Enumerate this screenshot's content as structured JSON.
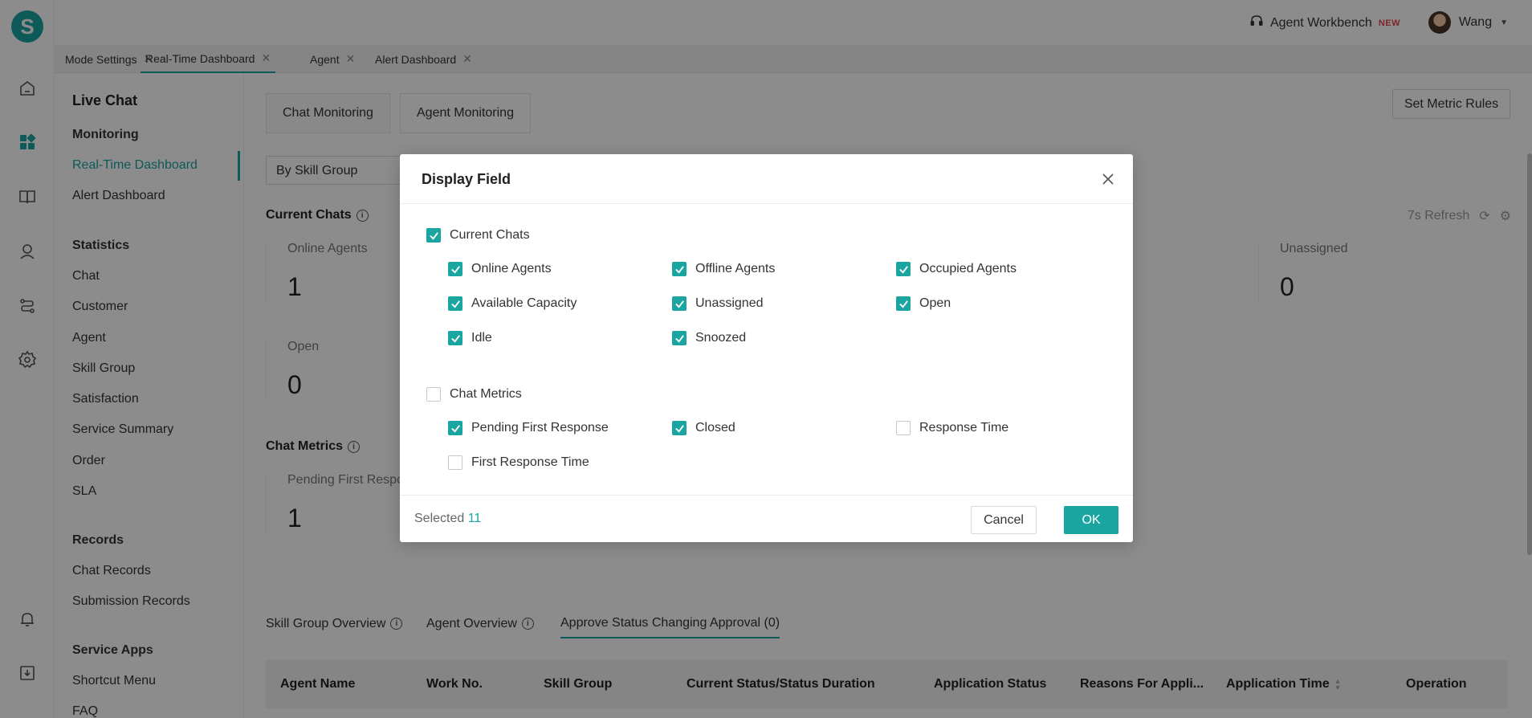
{
  "brand": {
    "logo_letter": "S",
    "accent": "#1aa5a0"
  },
  "topbar": {
    "workbench_label": "Agent Workbench",
    "new_badge": "NEW",
    "user_name": "Wang"
  },
  "page_tabs": [
    {
      "label": "Mode Settings",
      "active": false
    },
    {
      "label": "Real-Time Dashboard",
      "active": true
    },
    {
      "label": "Agent",
      "active": false
    },
    {
      "label": "Alert Dashboard",
      "active": false
    }
  ],
  "sidebar": {
    "title": "Live Chat",
    "groups": {
      "monitoring": "Monitoring",
      "statistics": "Statistics",
      "records": "Records",
      "service_apps": "Service Apps"
    },
    "items": {
      "realtime": "Real-Time Dashboard",
      "alert": "Alert Dashboard",
      "chat": "Chat",
      "customer": "Customer",
      "agent": "Agent",
      "skill_group": "Skill Group",
      "satisfaction": "Satisfaction",
      "service_summary": "Service Summary",
      "order": "Order",
      "sla": "SLA",
      "chat_records": "Chat Records",
      "submission_records": "Submission Records",
      "shortcut_menu": "Shortcut Menu",
      "faq": "FAQ"
    }
  },
  "main": {
    "tabs": {
      "chat_monitoring": "Chat Monitoring",
      "agent_monitoring": "Agent Monitoring"
    },
    "set_metric_rules": "Set Metric Rules",
    "group_select": "By Skill Group",
    "current_chats_title": "Current Chats",
    "refresh_label": "7s Refresh",
    "cards": {
      "online_agents": {
        "label": "Online Agents",
        "value": "1"
      },
      "unassigned": {
        "label": "Unassigned",
        "value": "0"
      },
      "open": {
        "label": "Open",
        "value": "0"
      },
      "pending_first": {
        "label": "Pending First Respon",
        "value": "1"
      }
    },
    "chat_metrics_title": "Chat Metrics",
    "bottom_tabs": {
      "skill_group_overview": "Skill Group Overview",
      "agent_overview": "Agent Overview",
      "approve": "Approve Status Changing Approval (0)"
    },
    "table_headers": {
      "agent_name": "Agent Name",
      "work_no": "Work No.",
      "skill_group": "Skill Group",
      "current_status": "Current Status/Status Duration",
      "application_status": "Application Status",
      "reasons": "Reasons For Appli...",
      "application_time": "Application Time",
      "operation": "Operation"
    }
  },
  "modal": {
    "title": "Display Field",
    "current_chats": {
      "label": "Current Chats",
      "checked": true,
      "fields": {
        "online_agents": {
          "label": "Online Agents",
          "checked": true
        },
        "offline_agents": {
          "label": "Offline Agents",
          "checked": true
        },
        "occupied_agents": {
          "label": "Occupied Agents",
          "checked": true
        },
        "available_capacity": {
          "label": "Available Capacity",
          "checked": true
        },
        "unassigned": {
          "label": "Unassigned",
          "checked": true
        },
        "open": {
          "label": "Open",
          "checked": true
        },
        "idle": {
          "label": "Idle",
          "checked": true
        },
        "snoozed": {
          "label": "Snoozed",
          "checked": true
        }
      }
    },
    "chat_metrics": {
      "label": "Chat Metrics",
      "checked": false,
      "fields": {
        "pending_first_response": {
          "label": "Pending First Response",
          "checked": true
        },
        "closed": {
          "label": "Closed",
          "checked": true
        },
        "response_time": {
          "label": "Response Time",
          "checked": false
        },
        "first_response_time": {
          "label": "First Response Time",
          "checked": false
        }
      }
    },
    "selected_label": "Selected",
    "selected_count": "11",
    "cancel": "Cancel",
    "ok": "OK"
  }
}
